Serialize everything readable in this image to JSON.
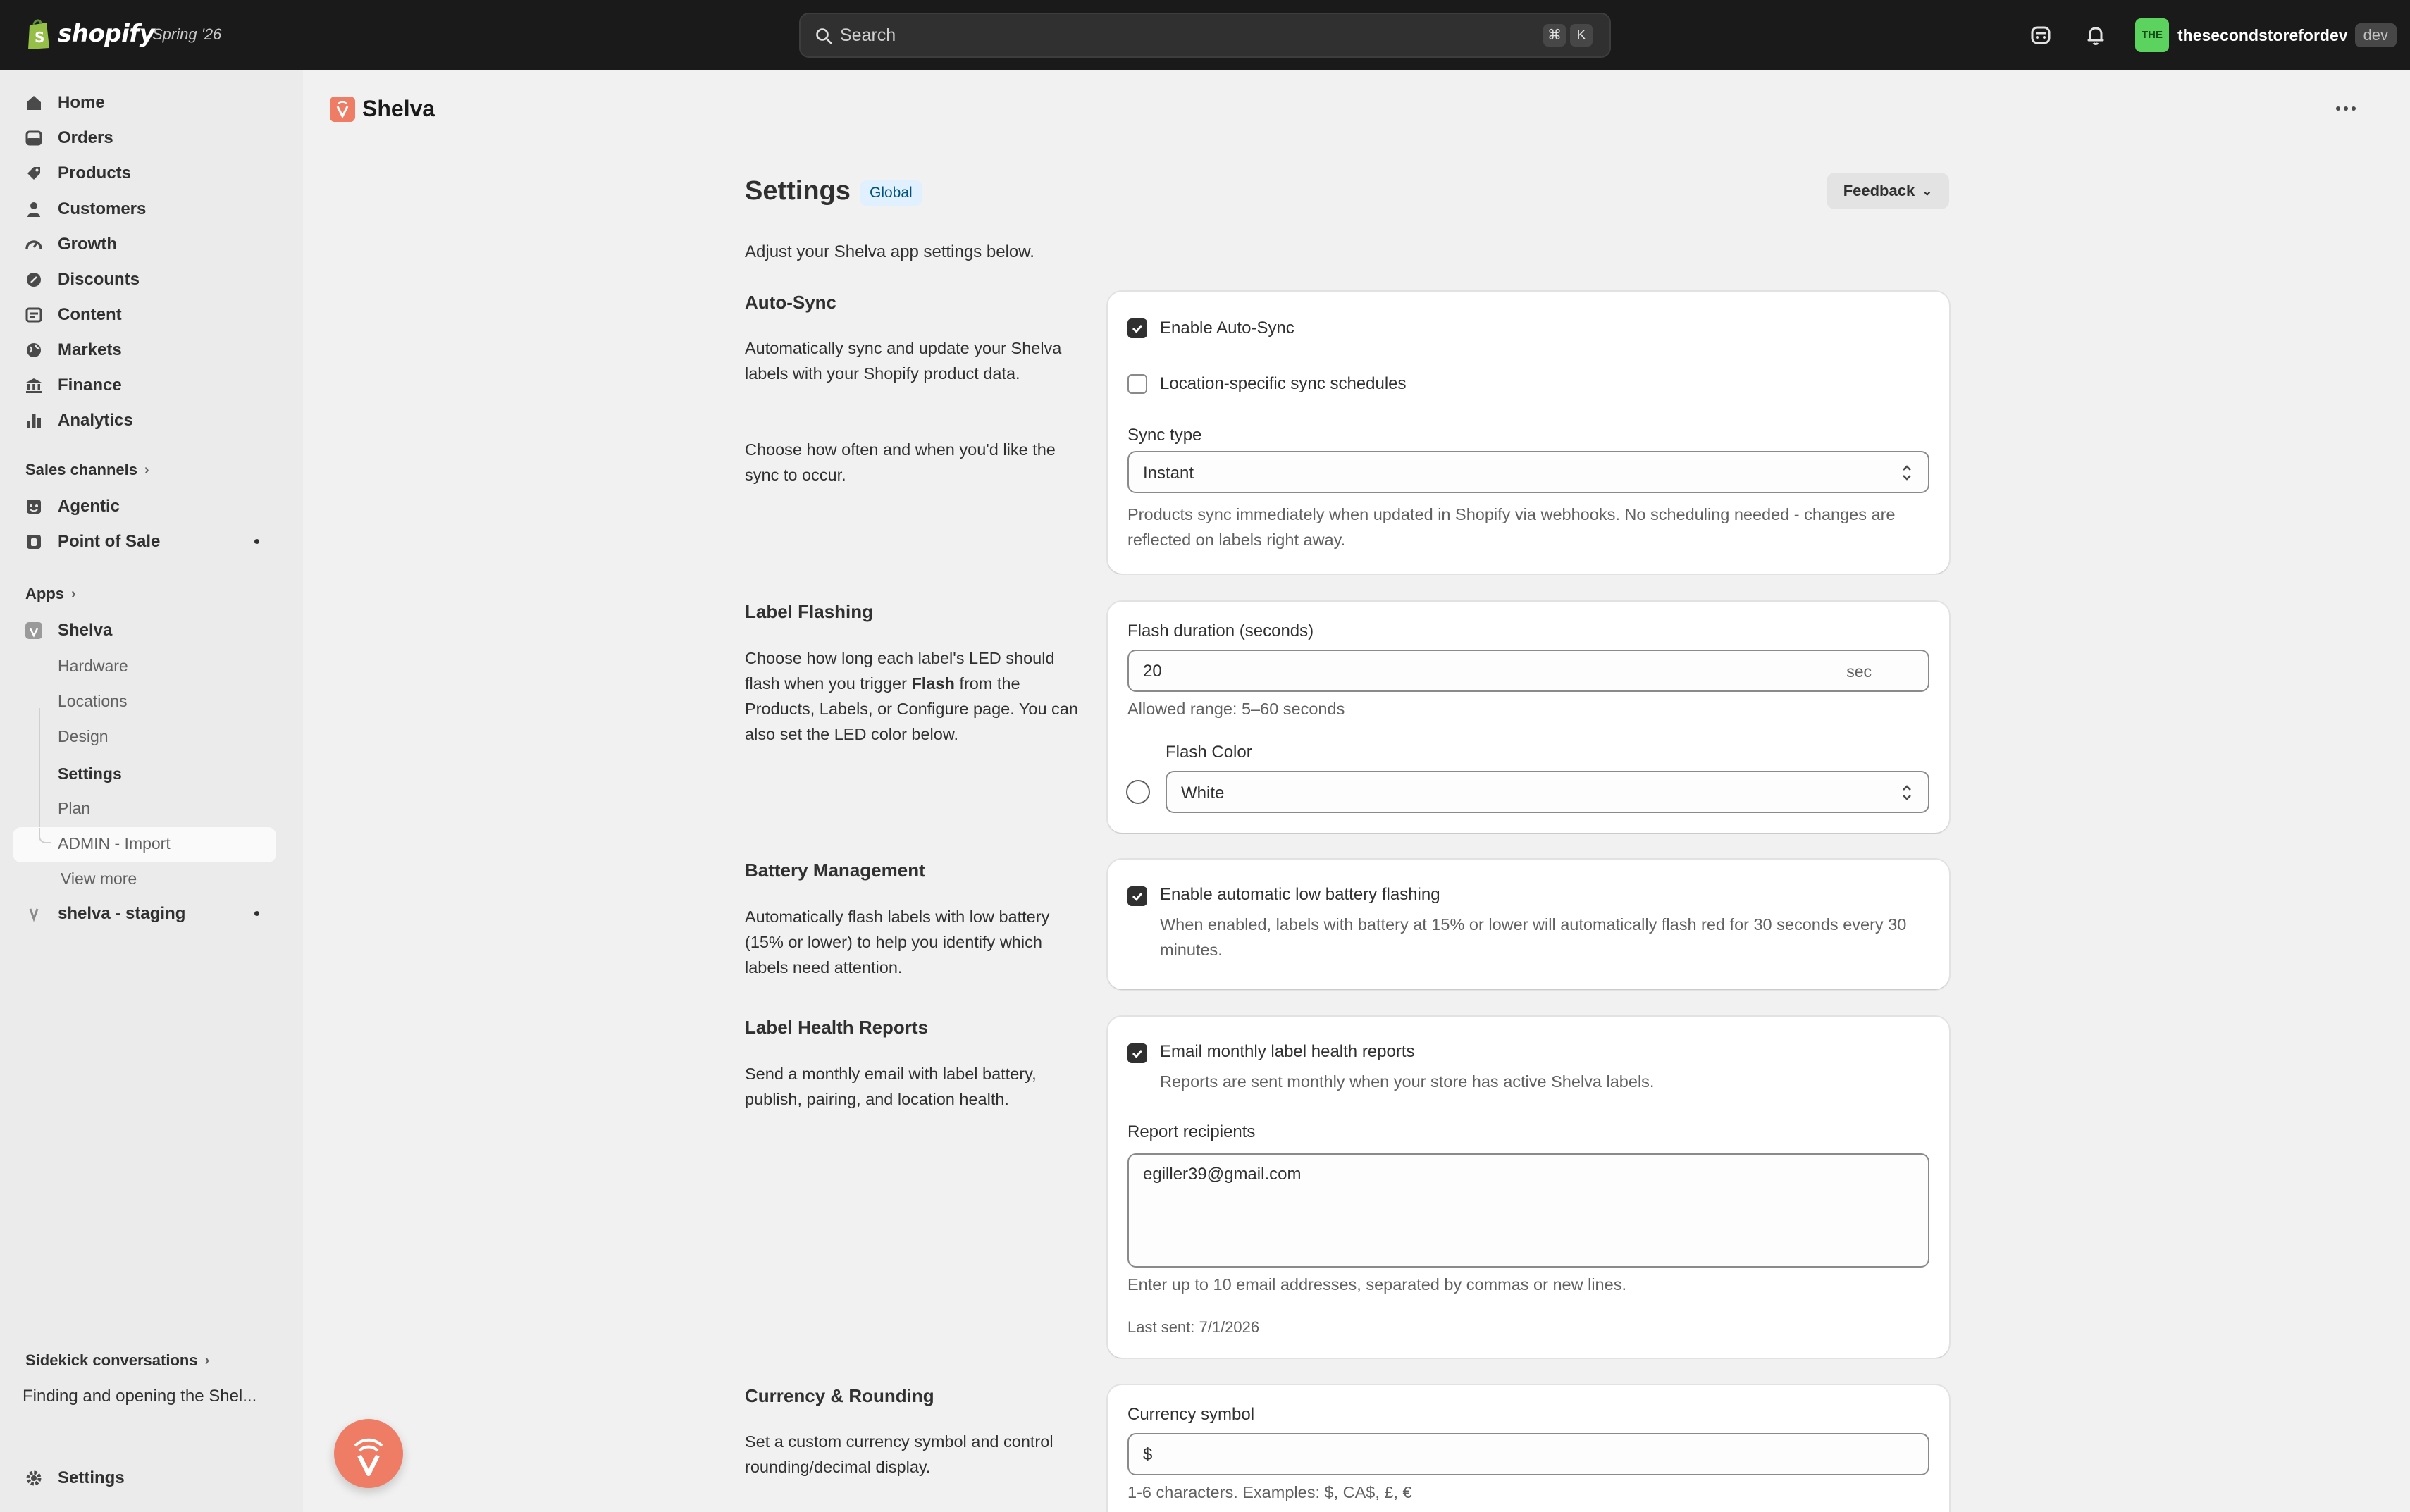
{
  "topbar": {
    "brand": "shopify",
    "edition": "Spring '26",
    "search_placeholder": "Search",
    "kbd_cmd": "⌘",
    "kbd_k": "K",
    "store_avatar": "THE",
    "store_name": "thesecondstorefordev",
    "store_badge": "dev"
  },
  "sidebar": {
    "main_items": [
      {
        "label": "Home",
        "icon": "home-icon"
      },
      {
        "label": "Orders",
        "icon": "orders-icon"
      },
      {
        "label": "Products",
        "icon": "tag-icon"
      },
      {
        "label": "Customers",
        "icon": "person-icon"
      },
      {
        "label": "Growth",
        "icon": "gauge-icon"
      },
      {
        "label": "Discounts",
        "icon": "discount-icon"
      },
      {
        "label": "Content",
        "icon": "content-icon"
      },
      {
        "label": "Markets",
        "icon": "globe-icon"
      },
      {
        "label": "Finance",
        "icon": "bank-icon"
      },
      {
        "label": "Analytics",
        "icon": "bar-chart-icon"
      }
    ],
    "sales_channels_header": "Sales channels",
    "channels": [
      {
        "label": "Agentic"
      },
      {
        "label": "Point of Sale"
      }
    ],
    "apps_header": "Apps",
    "app_name": "Shelva",
    "app_subitems": [
      "Hardware",
      "Locations",
      "Design",
      "Settings",
      "Plan",
      "ADMIN - Import"
    ],
    "view_more": "View more",
    "staging_app": "shelva - staging",
    "sidekick_header": "Sidekick conversations",
    "sidekick_item": "Finding and opening the Shel...",
    "settings": "Settings"
  },
  "app": {
    "title": "Shelva",
    "accent": "#ef7d66"
  },
  "page": {
    "title": "Settings",
    "badge": "Global",
    "feedback": "Feedback",
    "intro": "Adjust your Shelva app settings below."
  },
  "autosync": {
    "title": "Auto-Sync",
    "desc1": "Automatically sync and update your Shelva labels with your Shopify product data.",
    "desc2": "Choose how often and when you'd like the sync to occur.",
    "enable_label": "Enable Auto-Sync",
    "enable_checked": true,
    "location_label": "Location-specific sync schedules",
    "location_checked": false,
    "sync_type_label": "Sync type",
    "sync_type_value": "Instant",
    "help": "Products sync immediately when updated in Shopify via webhooks. No scheduling needed - changes are reflected on labels right away."
  },
  "flashing": {
    "title": "Label Flashing",
    "desc_part1": "Choose how long each label's LED should flash when you trigger ",
    "desc_bold": "Flash",
    "desc_part2": " from the Products, Labels, or Configure page. You can also set the LED color below.",
    "duration_label": "Flash duration (seconds)",
    "duration_value": "20",
    "duration_suffix": "sec",
    "duration_help": "Allowed range: 5–60 seconds",
    "color_label": "Flash Color",
    "color_value": "White"
  },
  "battery": {
    "title": "Battery Management",
    "desc": "Automatically flash labels with low battery (15% or lower) to help you identify which labels need attention.",
    "enable_label": "Enable automatic low battery flashing",
    "enable_checked": true,
    "help": "When enabled, labels with battery at 15% or lower will automatically flash red for 30 seconds every 30 minutes."
  },
  "health": {
    "title": "Label Health Reports",
    "desc": "Send a monthly email with label battery, publish, pairing, and location health.",
    "enable_label": "Email monthly label health reports",
    "enable_checked": true,
    "enable_help": "Reports are sent monthly when your store has active Shelva labels.",
    "recipients_label": "Report recipients",
    "recipients_value": "egiller39@gmail.com",
    "recipients_help": "Enter up to 10 email addresses, separated by commas or new lines.",
    "last_sent": "Last sent: 7/1/2026"
  },
  "currency": {
    "title": "Currency & Rounding",
    "desc": "Set a custom currency symbol and control rounding/decimal display.",
    "symbol_label": "Currency symbol",
    "symbol_value": "$",
    "symbol_help": "1-6 characters. Examples: $, CA$, £, €"
  }
}
